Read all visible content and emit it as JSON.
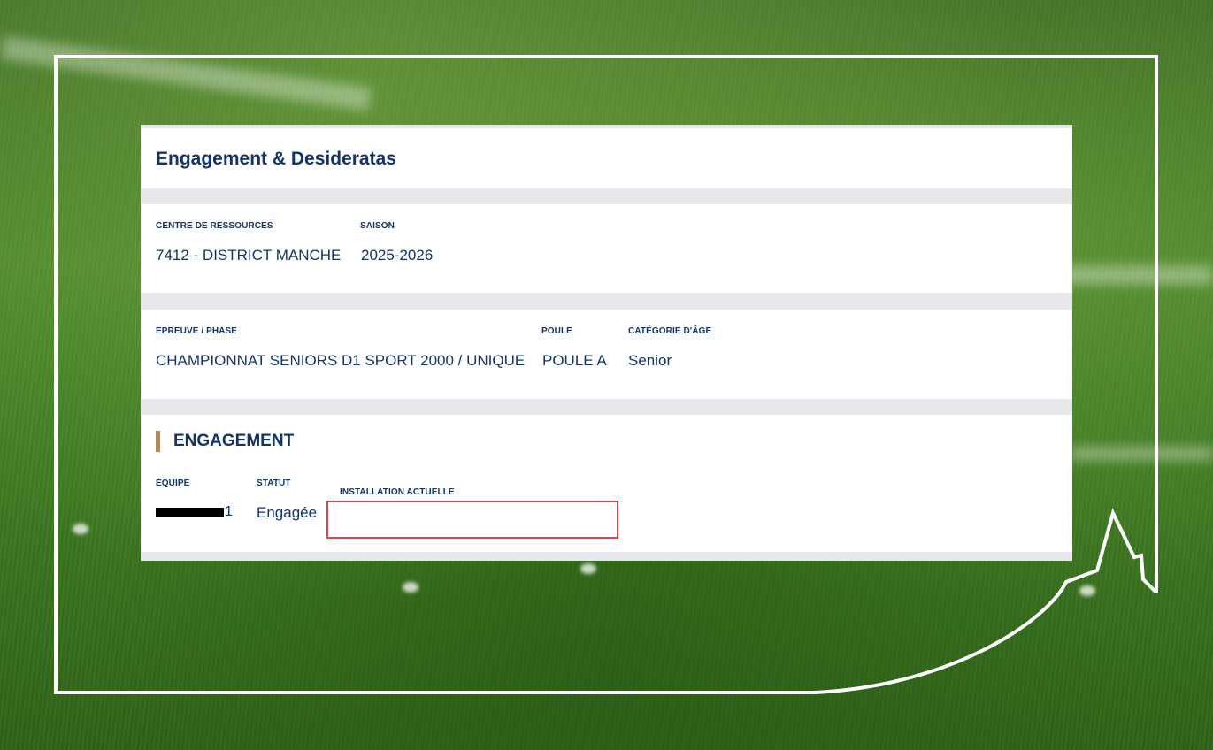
{
  "page": {
    "title": "Engagement & Desideratas"
  },
  "centre": {
    "centre_label": "CENTRE DE RESSOURCES",
    "centre_value": "7412 - DISTRICT MANCHE",
    "saison_label": "SAISON",
    "saison_value": "2025-2026"
  },
  "epreuve": {
    "epreuve_label": "EPREUVE / PHASE",
    "epreuve_value": "CHAMPIONNAT SENIORS D1 SPORT 2000 / UNIQUE",
    "poule_label": "POULE",
    "poule_value": "POULE A",
    "categorie_label": "CATÉGORIE D'ÂGE",
    "categorie_value": "Senior"
  },
  "engagement": {
    "heading": "ENGAGEMENT",
    "equipe_label": "ÉQUIPE",
    "equipe_suffix": "1",
    "statut_label": "STATUT",
    "statut_value": "Engagée",
    "installation_label": "INSTALLATION ACTUELLE",
    "installation_value": ""
  },
  "colors": {
    "text_navy": "#12346b",
    "accent_bar": "#b08a5e",
    "highlight_red": "#e2464c",
    "frame_white": "#ffffff"
  }
}
